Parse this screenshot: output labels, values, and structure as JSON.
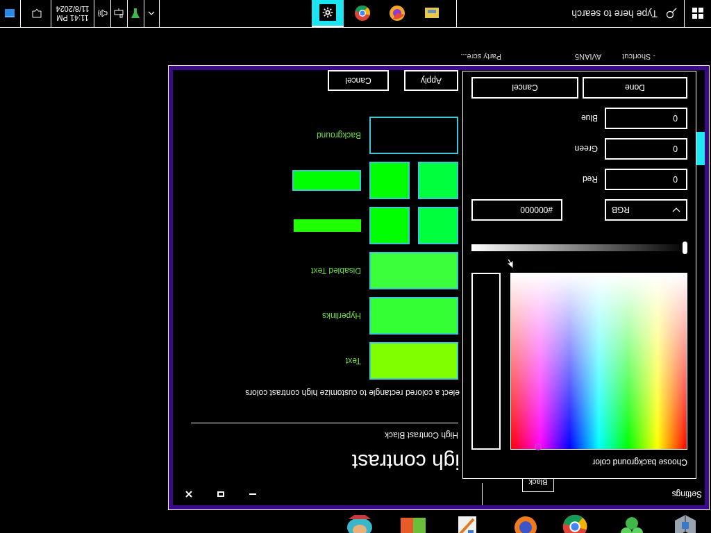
{
  "desktop": {
    "labels": [
      "- Shortcut",
      "AVIAN5",
      "Party scre..."
    ]
  },
  "window": {
    "title": "Settings",
    "nav": {
      "button": "Black"
    },
    "heading": "igh contrast",
    "theme": "High Contrast Black",
    "instruction": "elect a colored rectangle to customize high contrast colors",
    "color_rows": [
      {
        "kind": "swatch",
        "label": "Text",
        "color": "#7fff00"
      },
      {
        "kind": "swatch",
        "label": "Hyperlinks",
        "color": "#33ff33"
      },
      {
        "kind": "swatch",
        "label": "Disabled Text",
        "color": "#3cff3c"
      },
      {
        "kind": "pair",
        "swatches": [
          {
            "color": "#00ff3c"
          },
          {
            "color": "#00ff00"
          }
        ],
        "bar": {
          "color": "#20ff00"
        }
      },
      {
        "kind": "pair",
        "swatches": [
          {
            "color": "#00ff3c"
          },
          {
            "color": "#00ff00"
          }
        ],
        "bar": {
          "color": "#00ff00"
        }
      },
      {
        "kind": "swatch",
        "label": "Background",
        "color": "#000000"
      }
    ],
    "buttons": [
      "Apply",
      "Cancel"
    ]
  },
  "dialog": {
    "title": "Choose background color",
    "slider": {
      "level": 0
    },
    "mode": "RGB",
    "hex": "#000000",
    "fields": [
      {
        "label": "Red",
        "value": "0"
      },
      {
        "label": "Green",
        "value": "0"
      },
      {
        "label": "Blue",
        "value": "0"
      }
    ],
    "buttons": [
      "Done",
      "Cancel"
    ]
  },
  "taskbar": {
    "search": {
      "placeholder": "Type here to search"
    },
    "apps": [
      {
        "kind": "files",
        "selected": false
      },
      {
        "kind": "browser-orange",
        "selected": false
      },
      {
        "kind": "browser-round",
        "selected": false
      },
      {
        "kind": "settings",
        "selected": true
      }
    ],
    "clock": {
      "time": "11:41 PM",
      "date": "11/8/2024"
    }
  }
}
